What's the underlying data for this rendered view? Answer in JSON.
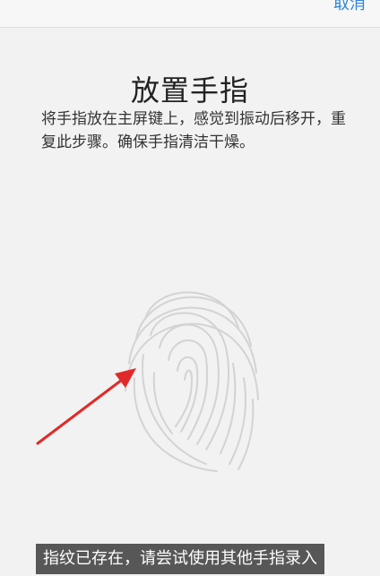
{
  "header": {
    "cancel_label": "取消"
  },
  "main": {
    "title": "放置手指",
    "description": "将手指放在主屏键上，感觉到振动后移开，重复此步骤。确保手指清洁干燥。"
  },
  "toast": {
    "message": "指纹已存在，请尝试使用其他手指录入"
  },
  "icons": {
    "fingerprint": "fingerprint-icon",
    "arrow": "arrow-icon"
  },
  "colors": {
    "accent": "#2f86d6",
    "arrow": "#e02a2a",
    "fingerprint": "#d3d3d3"
  }
}
